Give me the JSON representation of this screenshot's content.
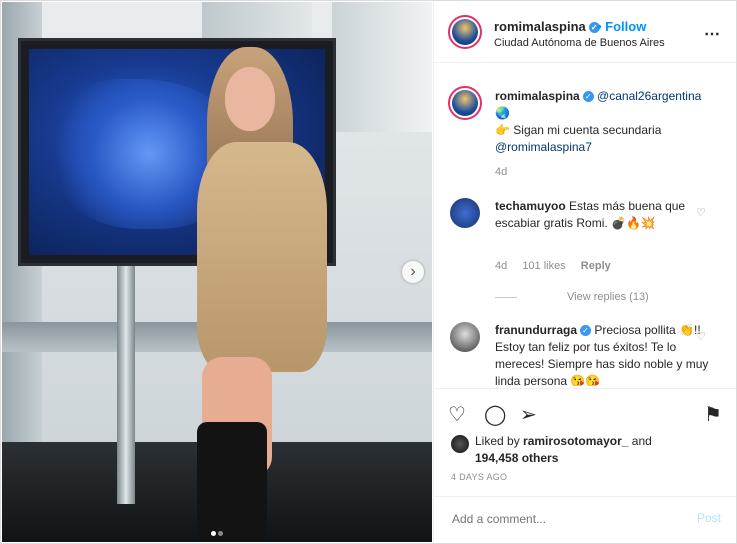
{
  "post": {
    "username": "romimalaspina",
    "follow_label": "Follow",
    "location": "Ciudad Autónoma de Buenos Aires",
    "more_icon": "⋯"
  },
  "caption": {
    "username": "romimalaspina",
    "mention": "@canal26argentina",
    "line2": "👉 Sigan mi cuenta secundaria",
    "mention2": "@romimalaspina7",
    "age": "4d"
  },
  "comments": [
    {
      "username": "techamuyoo",
      "text": "Estas más buena que escabiar gratis Romi. 💣🔥💥",
      "age": "4d",
      "likes": "101 likes",
      "reply_label": "Reply",
      "view_replies": "View replies (13)"
    },
    {
      "username": "franundurraga",
      "text": "Preciosa pollita 👏!! Estoy tan feliz por tus éxitos! Te lo mereces! Siempre has sido noble y muy linda persona 😘😘"
    }
  ],
  "likes": {
    "prefix": "Liked by",
    "user": "ramirosotomayor_",
    "and": "and",
    "count": "194,458 others"
  },
  "date": "4 DAYS AGO",
  "add_comment": {
    "placeholder": "Add a comment...",
    "post_label": "Post"
  },
  "colors": {
    "accent": "#0095f6",
    "verified": "#3897f0",
    "post_disabled": "#b2dffc"
  }
}
